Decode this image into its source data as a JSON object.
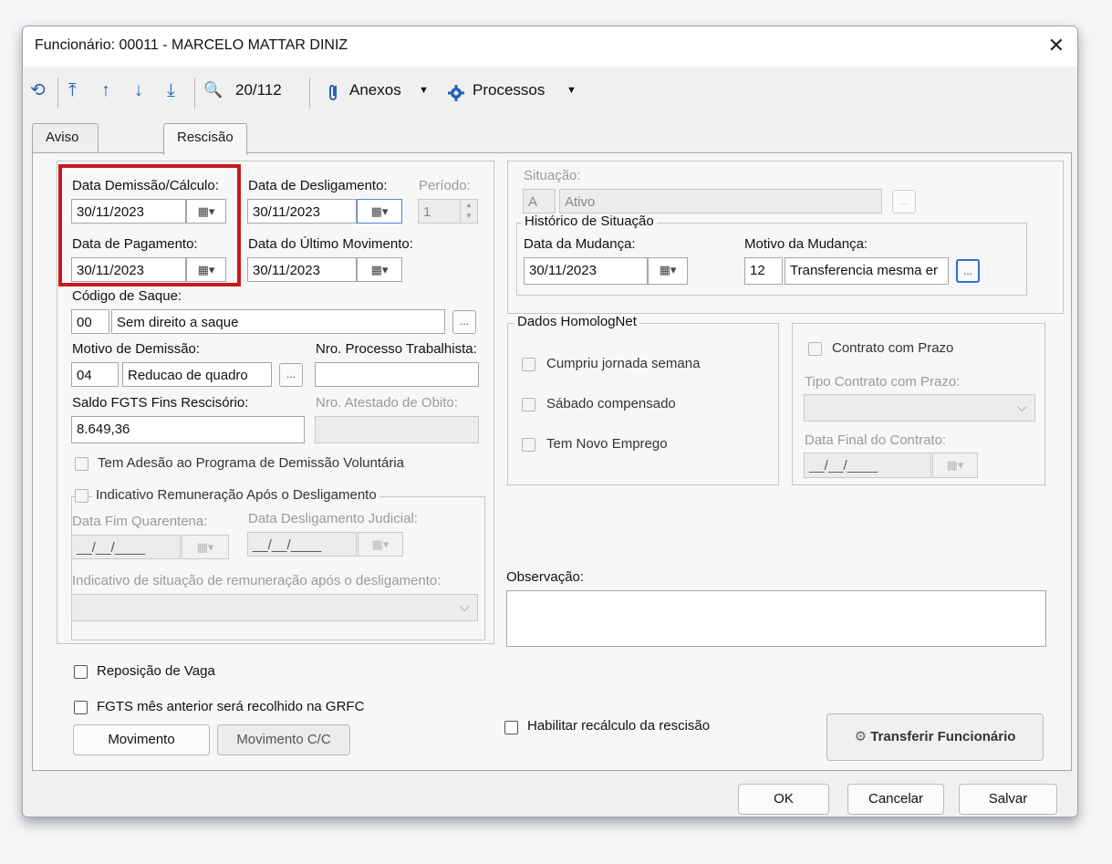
{
  "window": {
    "title": "Funcionário: 00011 - MARCELO MATTAR DINIZ",
    "close_glyph": "✕"
  },
  "toolbar": {
    "refresh_glyph": "⟲",
    "first_glyph": "⤒",
    "prev_glyph": "↑",
    "next_glyph": "↓",
    "last_glyph": "⤓",
    "search_glyph": "🔍",
    "record_counter": "20/112",
    "attachments_label": "Anexos",
    "processes_label": "Processos",
    "dropdown_glyph": "▼"
  },
  "tabs": [
    {
      "label": "Aviso Prévio"
    },
    {
      "label": "Rescisão"
    }
  ],
  "left": {
    "data_demissao": {
      "label": "Data Demissão/Cálculo:",
      "value": "30/11/2023"
    },
    "data_desligamento": {
      "label": "Data de Desligamento:",
      "value": "30/11/2023"
    },
    "periodo": {
      "label": "Período:",
      "value": "1"
    },
    "data_pagamento": {
      "label": "Data de Pagamento:",
      "value": "30/11/2023"
    },
    "data_ultimo_mov": {
      "label": "Data do Último Movimento:",
      "value": "30/11/2023"
    },
    "codigo_saque": {
      "label": "Código de Saque:",
      "code": "00",
      "desc": "Sem direito a saque"
    },
    "motivo_demissao": {
      "label": "Motivo de Demissão:",
      "code": "04",
      "desc": "Reducao de quadro"
    },
    "nro_processo": {
      "label": "Nro. Processo Trabalhista:",
      "value": ""
    },
    "saldo_fgts": {
      "label": "Saldo FGTS Fins Rescisório:",
      "value": "8.649,36"
    },
    "nro_atestado": {
      "label": "Nro. Atestado de Obito:",
      "value": ""
    },
    "adesao_pdv": "Tem Adesão ao Programa de Demissão Voluntária",
    "indicativo_remuneracao": "Indicativo Remuneração Após o Desligamento",
    "data_fim_quarentena": {
      "label": "Data Fim Quarentena:",
      "value": "__/__/____"
    },
    "data_deslig_judicial": {
      "label": "Data Desligamento Judicial:",
      "value": "__/__/____"
    },
    "indicativo_situacao": {
      "label": "Indicativo de situação de remuneração após o desligamento:",
      "value": ""
    }
  },
  "right": {
    "situacao": {
      "label": "Situação:",
      "code": "A",
      "desc": "Ativo"
    },
    "historico": {
      "legend": "Histórico de Situação",
      "data_mudanca": {
        "label": "Data da Mudança:",
        "value": "30/11/2023"
      },
      "motivo_mudanca": {
        "label": "Motivo da Mudança:",
        "code": "12",
        "desc": "Transferencia mesma er"
      }
    },
    "homolognet": {
      "legend": "Dados HomologNet",
      "cumpriu_jornada": "Cumpriu jornada semana",
      "sabado_compensado": "Sábado compensado",
      "novo_emprego": "Tem Novo Emprego"
    },
    "contrato": {
      "contrato_prazo": "Contrato com Prazo",
      "tipo_label": "Tipo Contrato com Prazo:",
      "tipo_value": "",
      "data_final_label": "Data Final do Contrato:",
      "data_final_value": "__/__/____"
    },
    "observacao": {
      "label": "Observação:",
      "value": ""
    }
  },
  "bottom": {
    "reposicao_vaga": "Reposição de Vaga",
    "fgts_anterior": "FGTS mês anterior será recolhido na GRFC",
    "movimento": "Movimento",
    "movimento_cc": "Movimento C/C",
    "habilitar_recalculo": "Habilitar recálculo da rescisão",
    "transferir": "Transferir Funcionário",
    "ok": "OK",
    "cancelar": "Cancelar",
    "salvar": "Salvar"
  },
  "colors": {
    "highlight": "#c51b1b",
    "toolbar_icon": "#2563b5"
  }
}
